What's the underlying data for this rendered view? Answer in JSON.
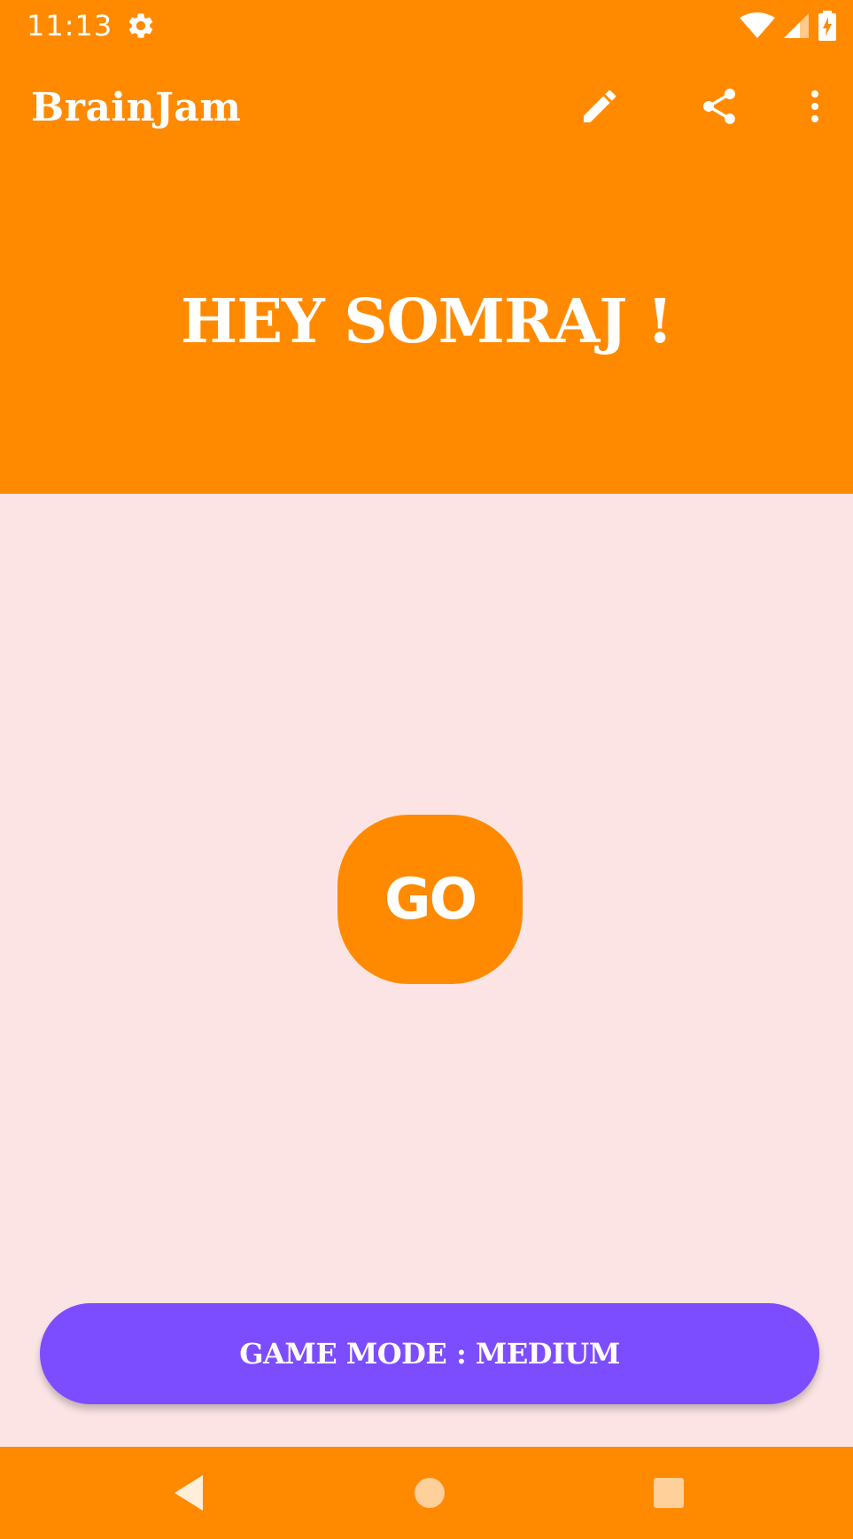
{
  "status_bar": {
    "time": "11:13",
    "icons": [
      "settings-gear-icon",
      "wifi-icon",
      "signal-icon",
      "battery-charging-icon"
    ]
  },
  "app_bar": {
    "title": "BrainJam",
    "actions": [
      "edit-pencil-icon",
      "share-icon",
      "more-vertical-icon"
    ]
  },
  "greeting": {
    "text": "HEY SOMRAJ !"
  },
  "go_button": {
    "label": "GO"
  },
  "game_mode_button": {
    "label": "GAME MODE : MEDIUM"
  },
  "nav_bar": {
    "buttons": [
      "back-icon",
      "home-icon",
      "recents-icon"
    ]
  },
  "colors": {
    "primary": "#FF8A00",
    "background": "#FCE4E4",
    "accent": "#7C4DFF",
    "on_primary": "#FFFFFF"
  }
}
